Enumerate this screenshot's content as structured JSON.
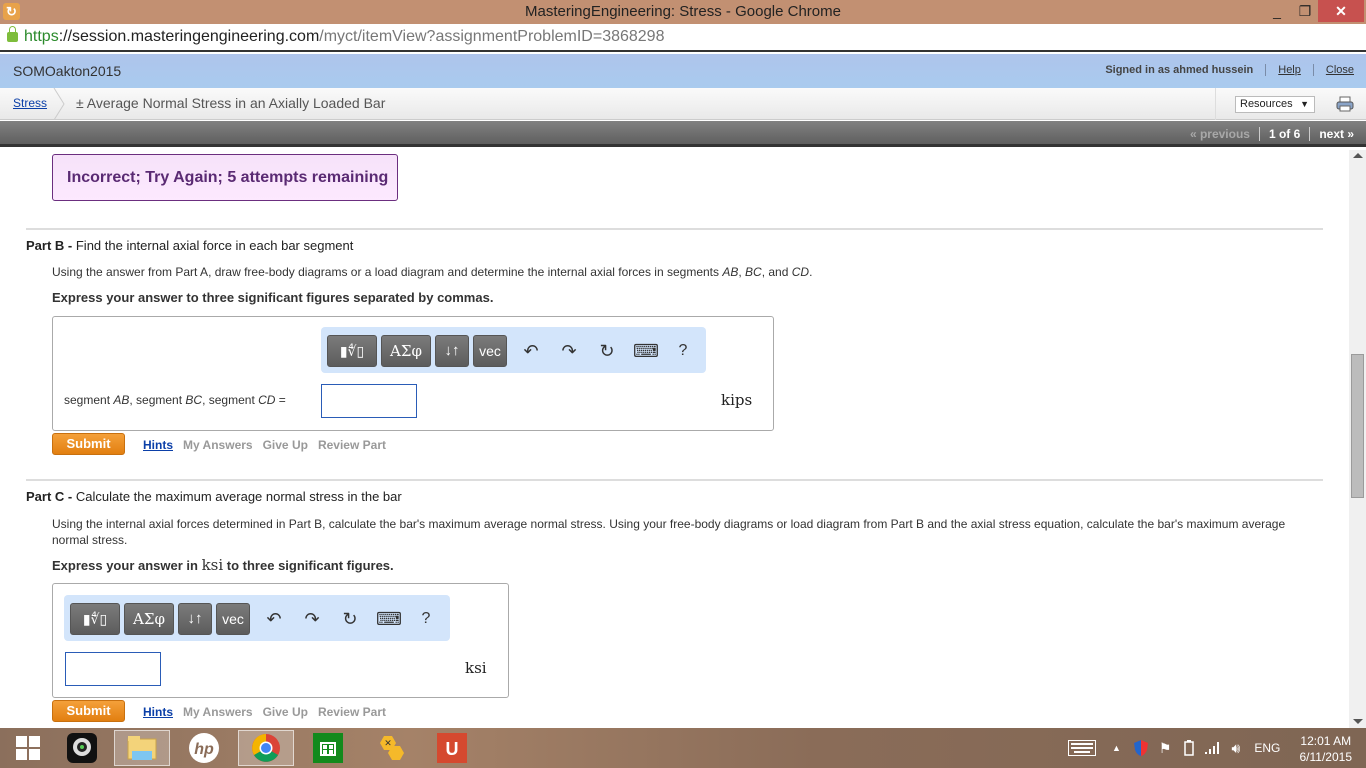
{
  "window": {
    "title": "MasteringEngineering: Stress - Google Chrome",
    "minimize_label": "_",
    "maximize_label": "❐",
    "close_label": "✕"
  },
  "address": {
    "scheme": "https",
    "host": "://session.masteringengineering.com",
    "path": "/myct/itemView?assignmentProblemID=3868298"
  },
  "header": {
    "course": "SOMOakton2015",
    "signed_in": "Signed in as ahmed hussein",
    "help": "Help",
    "close": "Close"
  },
  "breadcrumb": {
    "parent": "Stress",
    "problem": "± Average Normal Stress in an Axially Loaded Bar"
  },
  "resources": {
    "label": "Resources",
    "arrow": "▼"
  },
  "pagination": {
    "previous": "« previous",
    "position": "1 of 6",
    "next": "next »"
  },
  "feedback": {
    "text": "Incorrect; Try Again; 5 attempts remaining"
  },
  "toolbar": {
    "template_label": "▮∜▯",
    "greek_label": "ΑΣφ",
    "updown_label": "↓↑",
    "vec_label": "vec",
    "undo_icon": "↶",
    "redo_icon": "↷",
    "reset_icon": "↻",
    "keyboard_icon": "⌨",
    "help_icon": "?"
  },
  "partB": {
    "label": "Part B -",
    "title": "Find the internal axial force in each bar segment",
    "instructions_pre": "Using the answer from Part A, draw free-body diagrams or a load diagram and determine the internal axial forces in segments ",
    "seg_ab": "AB",
    "sep1": ", ",
    "seg_bc": "BC",
    "sep2": ", and ",
    "seg_cd": "CD",
    "period": ".",
    "express": "Express your answer to three significant figures separated by commas.",
    "input_label_pre": "segment ",
    "input_label_ab": "AB",
    "input_label_mid1": ", segment ",
    "input_label_bc": "BC",
    "input_label_mid2": ", segment ",
    "input_label_cd": "CD",
    "input_label_eq": " =",
    "input_value": "",
    "unit": "kips",
    "submit": "Submit",
    "hints": "Hints",
    "my_answers": "My Answers",
    "give_up": "Give Up",
    "review_part": "Review Part"
  },
  "partC": {
    "label": "Part C -",
    "title": "Calculate the maximum average normal stress in the bar",
    "instructions": "Using the internal axial forces determined in Part B, calculate the bar's maximum average normal stress. Using your free-body diagrams or load diagram from Part B and the axial stress equation, calculate the bar's maximum average normal stress.",
    "express_pre": "Express your answer in ",
    "express_unit": "ksi",
    "express_post": " to three significant figures.",
    "input_value": "",
    "unit": "ksi",
    "submit": "Submit",
    "hints": "Hints",
    "my_answers": "My Answers",
    "give_up": "Give Up",
    "review_part": "Review Part"
  },
  "taskbar": {
    "apps": [
      "start",
      "webcam",
      "file-explorer",
      "hp",
      "chrome",
      "store",
      "tools",
      "acrobat"
    ],
    "language": "ENG",
    "time": "12:01 AM",
    "date": "6/11/2015"
  }
}
